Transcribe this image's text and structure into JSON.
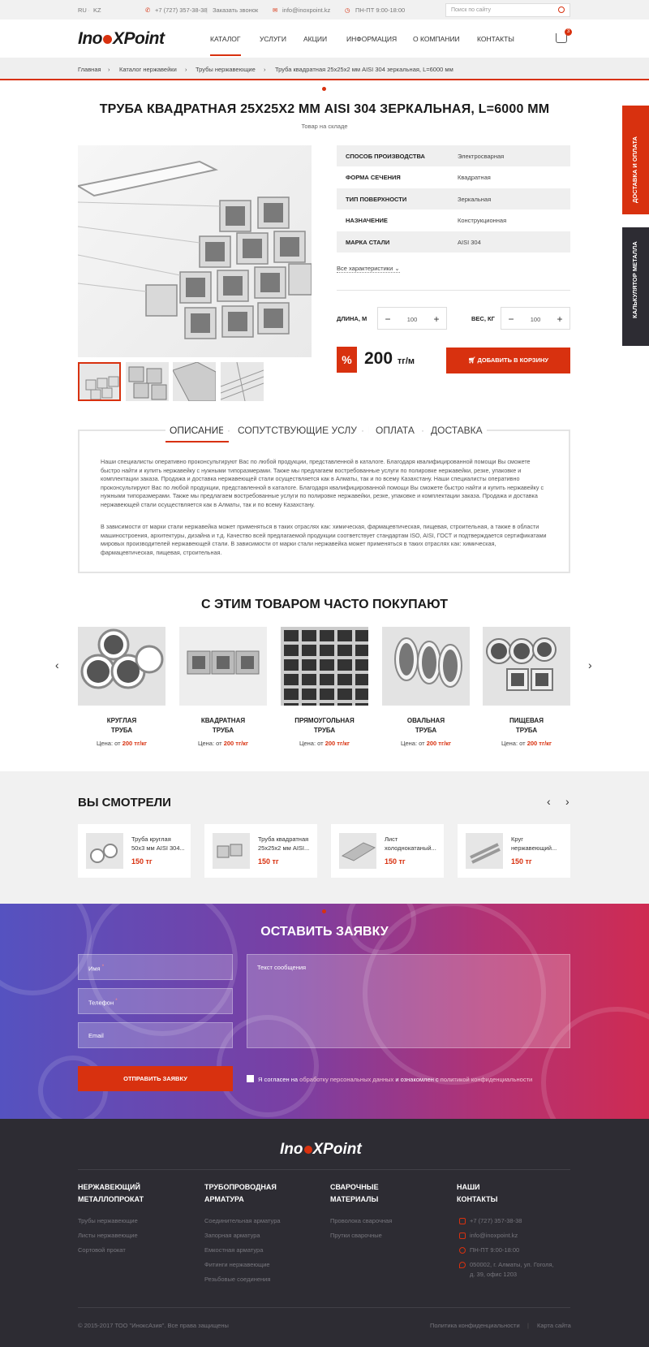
{
  "topbar": {
    "lang_ru": "RU",
    "lang_kz": "KZ",
    "phone": "+7 (727) 357-38-38",
    "callback": "Заказать звонок",
    "email": "info@inoxpoint.kz",
    "hours": "ПН-ПТ  9:00-18:00",
    "search_placeholder": "Поиск по сайту"
  },
  "header": {
    "logo": "InoXPoint",
    "nav": [
      "КАТАЛОГ",
      "УСЛУГИ",
      "АКЦИИ",
      "ИНФОРМАЦИЯ",
      "О КОМПАНИИ",
      "КОНТАКТЫ"
    ],
    "cart_count": "3"
  },
  "breadcrumb": [
    "Главная",
    "Каталог нержавейки",
    "Трубы нержавеющие",
    "Труба квадратная 25х25х2 мм AISI 304 зеркальная, L=6000 мм"
  ],
  "product": {
    "title": "ТРУБА КВАДРАТНАЯ 25Х25Х2 ММ AISI 304 ЗЕРКАЛЬНАЯ, L=6000 ММ",
    "stock": "Товар на складе",
    "specs": [
      {
        "k": "СПОСОБ ПРОИЗВОДСТВА",
        "v": "Электросварная"
      },
      {
        "k": "ФОРМА СЕЧЕНИЯ",
        "v": "Квадратная"
      },
      {
        "k": "ТИП ПОВЕРХНОСТИ",
        "v": "Зеркальная"
      },
      {
        "k": "НАЗНАЧЕНИЕ",
        "v": "Конструкционная"
      },
      {
        "k": "МАРКА СТАЛИ",
        "v": "AISI 304"
      }
    ],
    "all_specs": "Все характеристики",
    "length_label": "ДЛИНА, М",
    "length_value": "100",
    "weight_label": "ВЕС, КГ",
    "weight_value": "100",
    "percent": "%",
    "price": "200",
    "price_unit": "тг/м",
    "add_to_cart": "ДОБАВИТЬ В КОРЗИНУ"
  },
  "tabs": [
    "ОПИСАНИЕ",
    "СОПУТСТВУЮЩИЕ УСЛУГИ",
    "ОПЛАТА",
    "ДОСТАВКА"
  ],
  "description": [
    "Наши специалисты оперативно проконсультируют Вас по любой продукции, представленной в каталоге. Благодаря квалифицированной помощи Вы сможете быстро найти и купить нержавейку с нужными типоразмерами. Также мы предлагаем востребованные услуги по полировке нержавейки, резке, упаковке и комплектации заказа. Продажа и доставка нержавеющей стали осуществляется как в Алматы, так и по всему Казахстану. Наши специалисты оперативно проконсультируют Вас по любой продукции, представленной в каталоге. Благодаря квалифицированной помощи Вы сможете быстро найти и купить нержавейку с нужными типоразмерами. Также мы предлагаем востребованные услуги по полировке нержавейки, резке, упаковке и комплектации заказа. Продажа и доставка нержавеющей стали осуществляется как в Алматы, так и по всему Казахстану.",
    "В зависимости от марки стали нержавейка может применяться в таких отраслях как: химическая, фармацевтическая, пищевая, строительная, а также в области машиностроения, архитектуры, дизайна и т.д. Качество всей предлагаемой продукции соответствует стандартам ISO, AISI, ГОСТ и подтверждается сертификатами мировых производителей нержавеющей стали. В зависимости от марки стали нержавейка может применяться в таких отраслях как: химическая, фармацевтическая, пищевая, строительная."
  ],
  "related": {
    "title": "С ЭТИМ ТОВАРОМ ЧАСТО ПОКУПАЮТ",
    "price_prefix": "Цена:",
    "from": "от",
    "items": [
      {
        "l1": "КРУГЛАЯ",
        "l2": "ТРУБА",
        "price": "200 тг/кг"
      },
      {
        "l1": "КВАДРАТНАЯ",
        "l2": "ТРУБА",
        "price": "200 тг/кг"
      },
      {
        "l1": "ПРЯМОУГОЛЬНАЯ",
        "l2": "ТРУБА",
        "price": "200 тг/кг"
      },
      {
        "l1": "ОВАЛЬНАЯ",
        "l2": "ТРУБА",
        "price": "200 тг/кг"
      },
      {
        "l1": "ПИЩЕВАЯ",
        "l2": "ТРУБА",
        "price": "200 тг/кг"
      }
    ]
  },
  "viewed": {
    "title": "ВЫ СМОТРЕЛИ",
    "items": [
      {
        "l1": "Труба круглая",
        "l2": "50х3 мм AISI 304...",
        "price": "150 тг"
      },
      {
        "l1": "Труба квадратная",
        "l2": "25х25х2 мм AISI...",
        "price": "150 тг"
      },
      {
        "l1": "Лист",
        "l2": "холоднокатаный...",
        "price": "150 тг"
      },
      {
        "l1": "Круг",
        "l2": "нержавеющий...",
        "price": "150 тг"
      }
    ]
  },
  "form": {
    "title": "ОСТАВИТЬ ЗАЯВКУ",
    "name": "Имя",
    "phone": "Телефон",
    "email": "Email",
    "message": "Текст сообщения",
    "send": "ОТПРАВИТЬ ЗАЯВКУ",
    "agree_a": "Я согласен на ",
    "agree_b": "обработку персональных данных",
    "agree_c": " и ознакомлен с ",
    "agree_d": "политикой конфиденциальности",
    "required": "*"
  },
  "footer": {
    "logo": "InoXPoint",
    "col1": {
      "t1": "НЕРЖАВЕЮЩИЙ",
      "t2": "МЕТАЛЛОПРОКАТ",
      "links": [
        "Трубы нержавеющие",
        "Листы нержавеющие",
        "Сортовой прокат"
      ]
    },
    "col2": {
      "t1": "ТРУБОПРОВОДНАЯ",
      "t2": "АРМАТУРА",
      "links": [
        "Соединительная арматура",
        "Запорная арматура",
        "Емкостная арматура",
        "Фитинги нержавеющие",
        "Резьбовые соединения"
      ]
    },
    "col3": {
      "t1": "СВАРОЧНЫЕ",
      "t2": "МАТЕРИАЛЫ",
      "links": [
        "Проволока сварочная",
        "Прутки сварочные"
      ]
    },
    "col4": {
      "t1": "НАШИ",
      "t2": "КОНТАКТЫ",
      "links": [
        "+7 (727) 357-38-38",
        "info@inoxpoint.kz",
        "ПН-ПТ  9:00-18:00",
        "050002, г. Алматы, ул. Гоголя,",
        "д. 39, офис 1203"
      ]
    },
    "copyright": "© 2015-2017 ТОО \"ИноксАзия\". Все права защищены",
    "privacy": "Политика конфиденциальности",
    "sitemap": "Карта сайта"
  },
  "side": {
    "delivery": "ДОСТАВКА И ОПЛАТА",
    "calculator": "КАЛЬКУЛЯТОР МЕТАЛЛА"
  },
  "colors": {
    "accent": "#d8310f",
    "footer_bg": "#2d2c33"
  }
}
